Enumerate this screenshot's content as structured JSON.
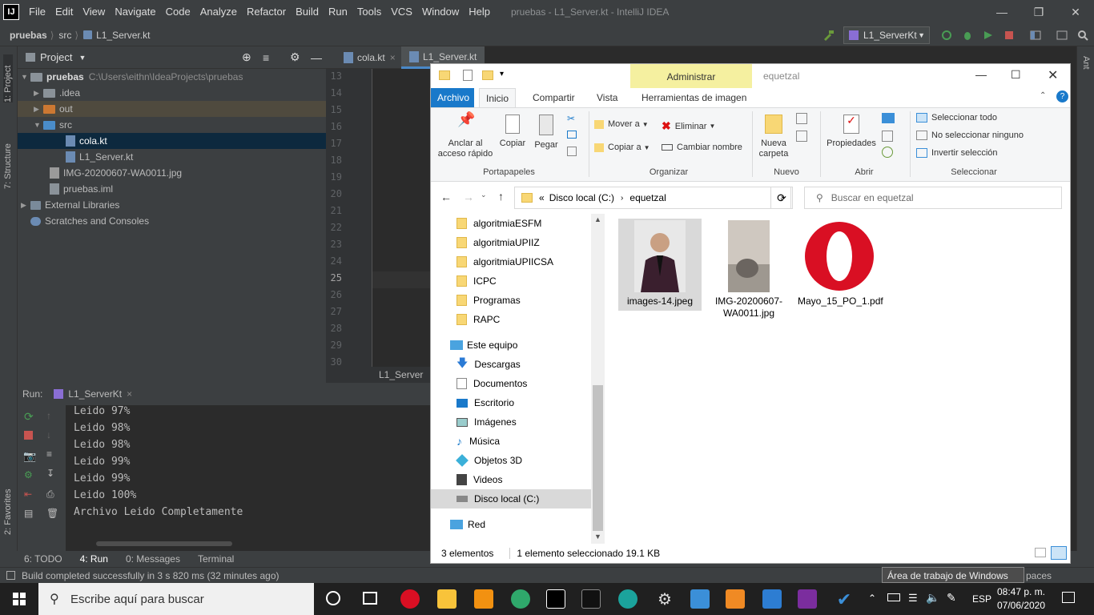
{
  "ide": {
    "menu": [
      "File",
      "Edit",
      "View",
      "Navigate",
      "Code",
      "Analyze",
      "Refactor",
      "Build",
      "Run",
      "Tools",
      "VCS",
      "Window",
      "Help"
    ],
    "window_title": "pruebas - L1_Server.kt - IntelliJ IDEA",
    "breadcrumb": [
      "pruebas",
      "src",
      "L1_Server.kt"
    ],
    "run_config": "L1_ServerKt",
    "left_tabs": [
      "1: Project",
      "7: Structure",
      "2: Favorites"
    ],
    "right_tabs": [
      "Ant"
    ],
    "project_header": "Project",
    "tree": [
      {
        "label": "pruebas",
        "detail": "C:\\Users\\eithn\\IdeaProjects\\pruebas"
      },
      {
        "label": ".idea"
      },
      {
        "label": "out"
      },
      {
        "label": "src"
      },
      {
        "label": "cola.kt"
      },
      {
        "label": "L1_Server.kt"
      },
      {
        "label": "IMG-20200607-WA0011.jpg"
      },
      {
        "label": "pruebas.iml"
      },
      {
        "label": "External Libraries"
      },
      {
        "label": "Scratches and Consoles"
      }
    ],
    "editor_tabs": [
      "cola.kt",
      "L1_Server.kt"
    ],
    "line_numbers": [
      "13",
      "14",
      "15",
      "16",
      "17",
      "18",
      "19",
      "20",
      "21",
      "22",
      "23",
      "24",
      "25",
      "26",
      "27",
      "28",
      "29",
      "30"
    ],
    "editor_footer": "L1_Server",
    "run_label": "Run:",
    "run_tab": "L1_ServerKt",
    "console": [
      "Leido 97%",
      "Leido 98%",
      "Leido 98%",
      "Leido 99%",
      "Leido 99%",
      "Leido 100%",
      "Archivo Leido Completamente"
    ],
    "bottom_tabs": [
      "6: TODO",
      "4: Run",
      "0: Messages",
      "Terminal"
    ],
    "status": "Build completed successfully in 3 s 820 ms (32 minutes ago)",
    "desktop_hint": "Área de trabajo de Windows Ink",
    "spaces_fragment": "paces"
  },
  "explorer": {
    "contextual_tab": "Administrar",
    "title": "equetzal",
    "ribbon_tabs": [
      "Archivo",
      "Inicio",
      "Compartir",
      "Vista",
      "Herramientas de imagen"
    ],
    "ribbon": {
      "pin": "Anclar al acceso rápido",
      "copy": "Copiar",
      "paste": "Pegar",
      "group_clipboard": "Portapapeles",
      "move_to": "Mover a",
      "copy_to": "Copiar a",
      "delete": "Eliminar",
      "rename": "Cambiar nombre",
      "group_organize": "Organizar",
      "new_folder": "Nueva carpeta",
      "group_new": "Nuevo",
      "properties": "Propiedades",
      "group_open": "Abrir",
      "select_all": "Seleccionar todo",
      "select_none": "No seleccionar ninguno",
      "invert": "Invertir selección",
      "group_select": "Seleccionar"
    },
    "address": [
      "Disco local (C:)",
      "equetzal"
    ],
    "search_placeholder": "Buscar en equetzal",
    "nav": [
      "algoritmiaESFM",
      "algoritmiaUPIIZ",
      "algoritmiaUPIICSA",
      "ICPC",
      "Programas",
      "RAPC",
      "Este equipo",
      "Descargas",
      "Documentos",
      "Escritorio",
      "Imágenes",
      "Música",
      "Objetos 3D",
      "Videos",
      "Disco local (C:)",
      "Red"
    ],
    "files": [
      {
        "name": "images-14.jpeg"
      },
      {
        "name": "IMG-20200607-WA0011.jpg"
      },
      {
        "name": "Mayo_15_PO_1.pdf"
      }
    ],
    "status_count": "3 elementos",
    "status_selected": "1 elemento seleccionado  19.1 KB"
  },
  "taskbar": {
    "search_placeholder": "Escribe aquí para buscar",
    "language": "ESP",
    "time": "08:47 p. m.",
    "date": "07/06/2020"
  }
}
